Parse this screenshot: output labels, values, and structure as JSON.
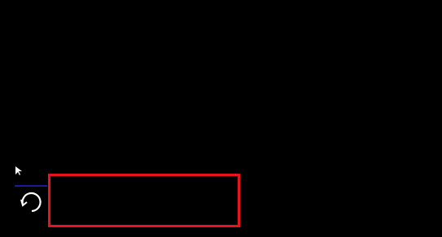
{
  "colors": {
    "background": "#000000",
    "highlight": "#e8141b",
    "accent_line": "#1a1a9a",
    "icon": "#ffffff"
  },
  "icons": {
    "cursor": "mouse-pointer-icon",
    "avatar": "refresh-icon"
  }
}
